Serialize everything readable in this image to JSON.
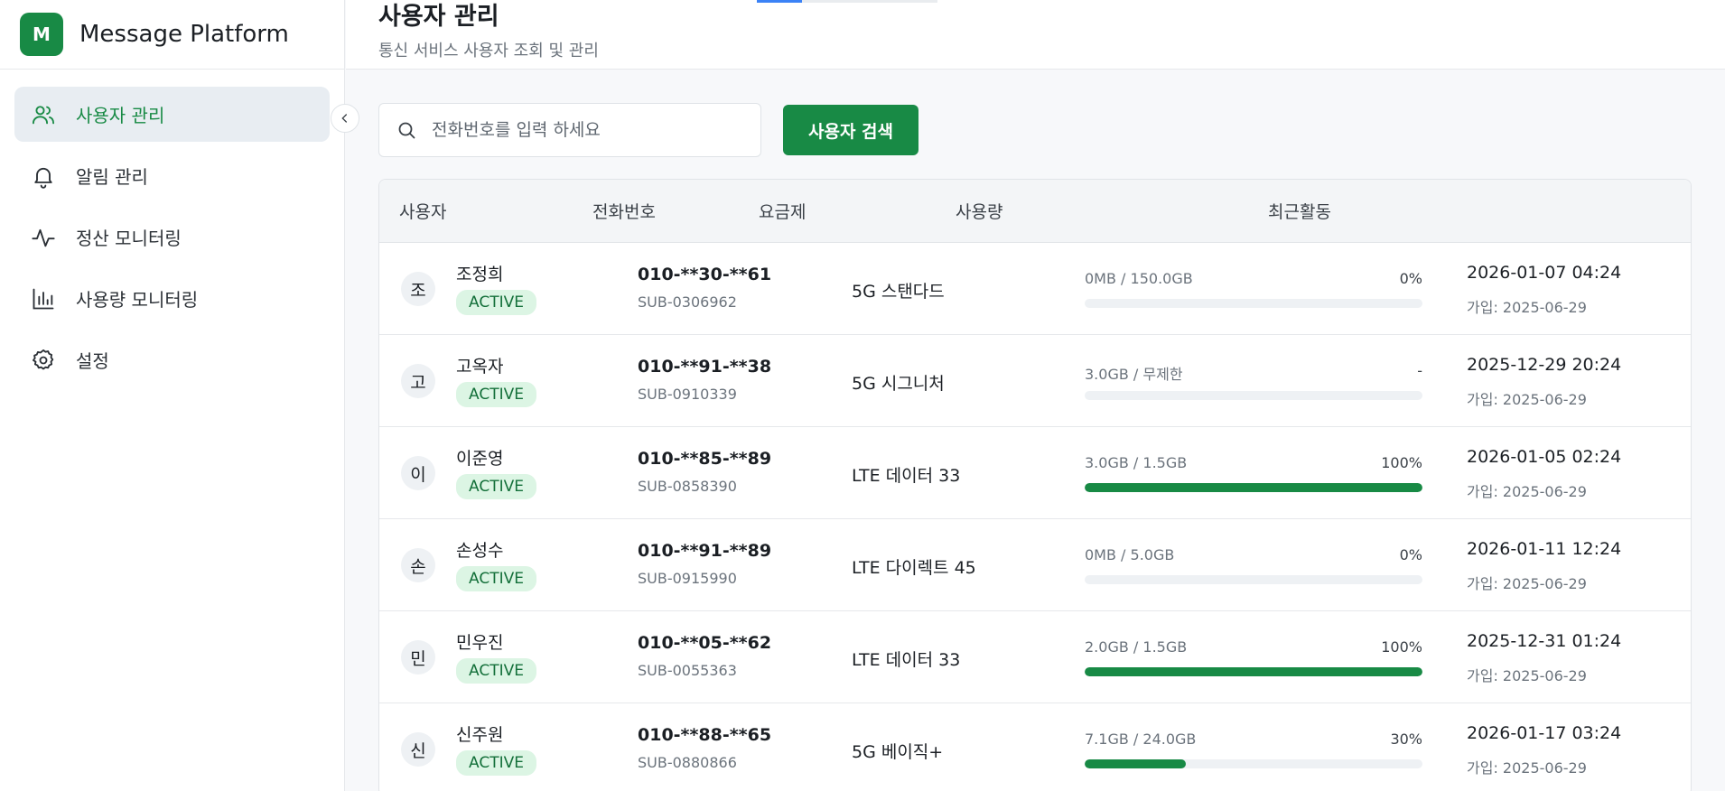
{
  "brand": {
    "logo": "M",
    "title": "Message Platform"
  },
  "nav": [
    {
      "label": "사용자 관리",
      "icon": "users-icon",
      "active": true
    },
    {
      "label": "알림 관리",
      "icon": "bell-icon",
      "active": false
    },
    {
      "label": "정산 모니터링",
      "icon": "activity-icon",
      "active": false
    },
    {
      "label": "사용량 모니터링",
      "icon": "bar-chart-icon",
      "active": false
    },
    {
      "label": "설정",
      "icon": "gear-icon",
      "active": false
    }
  ],
  "header": {
    "title": "사용자 관리",
    "subtitle": "통신 서비스 사용자 조회 및 관리"
  },
  "search": {
    "placeholder": "전화번호를 입력 하세요",
    "value": "",
    "button": "사용자 검색"
  },
  "table": {
    "columns": [
      "사용자",
      "전화번호",
      "요금제",
      "사용량",
      "최근활동"
    ],
    "rows": [
      {
        "initial": "조",
        "name": "조정희",
        "status": "ACTIVE",
        "phone": "010-**30-**61",
        "sub": "SUB-0306962",
        "plan": "5G 스탠다드",
        "usage": "0MB / 150.0GB",
        "pct": "0%",
        "fill": 0,
        "recent": "2026-01-07 04:24",
        "joined": "가입: 2025-06-29"
      },
      {
        "initial": "고",
        "name": "고옥자",
        "status": "ACTIVE",
        "phone": "010-**91-**38",
        "sub": "SUB-0910339",
        "plan": "5G 시그니처",
        "usage": "3.0GB / 무제한",
        "pct": "-",
        "fill": 0,
        "recent": "2025-12-29 20:24",
        "joined": "가입: 2025-06-29"
      },
      {
        "initial": "이",
        "name": "이준영",
        "status": "ACTIVE",
        "phone": "010-**85-**89",
        "sub": "SUB-0858390",
        "plan": "LTE 데이터 33",
        "usage": "3.0GB / 1.5GB",
        "pct": "100%",
        "fill": 100,
        "recent": "2026-01-05 02:24",
        "joined": "가입: 2025-06-29"
      },
      {
        "initial": "손",
        "name": "손성수",
        "status": "ACTIVE",
        "phone": "010-**91-**89",
        "sub": "SUB-0915990",
        "plan": "LTE 다이렉트 45",
        "usage": "0MB / 5.0GB",
        "pct": "0%",
        "fill": 0,
        "recent": "2026-01-11 12:24",
        "joined": "가입: 2025-06-29"
      },
      {
        "initial": "민",
        "name": "민우진",
        "status": "ACTIVE",
        "phone": "010-**05-**62",
        "sub": "SUB-0055363",
        "plan": "LTE 데이터 33",
        "usage": "2.0GB / 1.5GB",
        "pct": "100%",
        "fill": 100,
        "recent": "2025-12-31 01:24",
        "joined": "가입: 2025-06-29"
      },
      {
        "initial": "신",
        "name": "신주원",
        "status": "ACTIVE",
        "phone": "010-**88-**65",
        "sub": "SUB-0880866",
        "plan": "5G 베이직+",
        "usage": "7.1GB / 24.0GB",
        "pct": "30%",
        "fill": 30,
        "recent": "2026-01-17 03:24",
        "joined": "가입: 2025-06-29"
      }
    ]
  },
  "colors": {
    "accent": "#188a45",
    "badge_bg": "#dcf5e4",
    "badge_text": "#14703a"
  }
}
